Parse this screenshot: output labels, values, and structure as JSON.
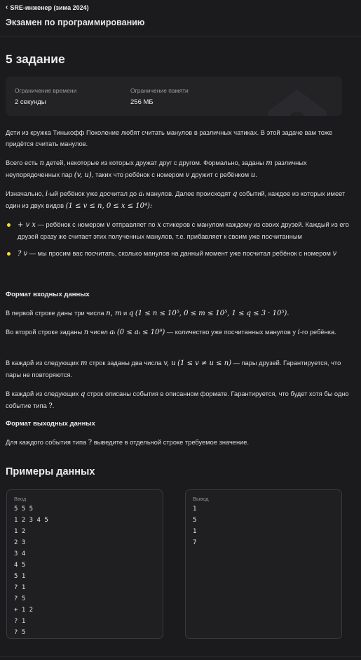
{
  "header": {
    "back_label": "SRE-инженер (зима 2024)",
    "exam_title": "Экзамен по программированию"
  },
  "task": {
    "title": "5 задание",
    "limits": {
      "time_label": "Ограничение времени",
      "time_value": "2 секунды",
      "memory_label": "Ограничение памяти",
      "memory_value": "256 МБ"
    }
  },
  "statement": {
    "p1": "Дети из кружка Тинькофф Поколение любят считать манулов в различных чатиках. В этой задаче вам тоже придётся считать манулов.",
    "p2_a": "Всего есть ",
    "p2_b": " детей, некоторые из которых дружат друг с другом. Формально, заданы ",
    "p2_c": " различных неупорядоченных пар ",
    "p2_d": ", таких что ребёнок с номером ",
    "p2_e": " дружит с ребёнком ",
    "p3_a": "Изначально, ",
    "p3_b": "-ый ребёнок уже досчитал до ",
    "p3_c": " манулов. Далее происходят ",
    "p3_d": " событий, каждое из которых имеет один из двух видов ",
    "b1_a": " — ребёнок с номером ",
    "b1_b": " отправляет по ",
    "b1_c": " стикеров с манулом каждому из своих друзей. Каждый из его друзей сразу же считает этих полученных манулов, т.е. прибавляет к своим уже посчитанным",
    "b2_a": " — мы просим вас посчитать, сколько манулов на данный момент уже посчитал ребёнок с номером "
  },
  "input_format": {
    "heading": "Формат входных данных",
    "p1_a": "В первой строке даны три числа ",
    "p1_and": " и ",
    "p2_a": "Во второй строке заданы ",
    "p2_b": " чисел ",
    "p2_c": " — количество уже посчитанных манулов у ",
    "p2_d": "-го ребёнка.",
    "p3_a": "В каждой из следующих ",
    "p3_b": " строк заданы два числа ",
    "p3_c": " — пары друзей. Гарантируется, что пары не повторяются.",
    "p4_a": "В каждой из следующих ",
    "p4_b": " строк описаны события в описанном формате. Гарантируется, что будет хотя бы одно событие типа "
  },
  "output_format": {
    "heading": "Формат выходных данных",
    "p1_a": "Для каждого события типа ",
    "p1_b": " выведите в отдельной строке требуемое значение."
  },
  "math": {
    "n": "n",
    "m": "m",
    "q": "q",
    "v": "v",
    "u": "u",
    "i": "i",
    "x": "x",
    "a_i": "aᵢ",
    "pair_vu": "(v, u)",
    "events_range": "(1 ≤ v ≤ n, 0 ≤ x ≤ 10⁴):",
    "plus_vx": "+ v x",
    "q_v": "? v",
    "q_mark": "?",
    "nm": "n, m",
    "input_range": "(1 ≤ n ≤ 10⁵, 0 ≤ m ≤ 10⁵, 1 ≤ q ≤ 3 · 10⁵).",
    "a_range": "(0 ≤ aᵢ ≤ 10⁹)",
    "vu": "v, u",
    "vu_range": "(1 ≤ v ≠ u ≤ n)",
    "period": ".",
    "colon": ":"
  },
  "examples": {
    "title": "Примеры данных",
    "input_label": "Ввод",
    "output_label": "Вывод",
    "input_lines": [
      "5 5 5",
      "1 2 3 4 5",
      "1 2",
      "2 3",
      "3 4",
      "4 5",
      "5 1",
      "? 1",
      "? 5",
      "+ 1 2",
      "? 1",
      "? 5"
    ],
    "output_lines": [
      "1",
      "5",
      "1",
      "7"
    ]
  },
  "colors": {
    "background": "#1b1b1d",
    "card": "#232326",
    "bullet_accent": "#ffdd2d"
  },
  "icons": {
    "back": "chevron-left-icon",
    "watermark": "home-watermark-icon"
  }
}
